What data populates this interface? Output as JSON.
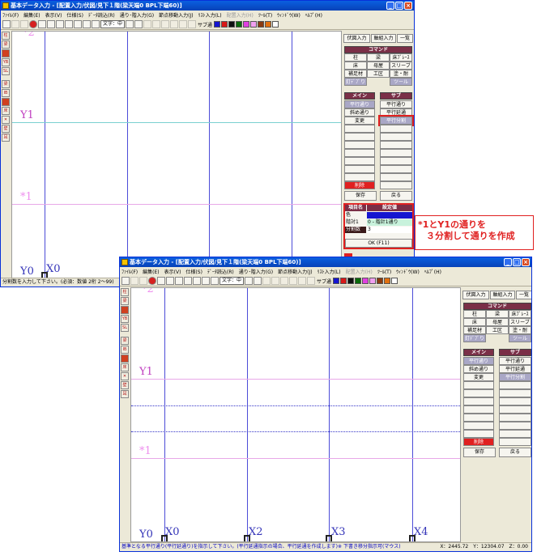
{
  "window1": {
    "title": "基本データ入力 - [配置入力/伏図/見下１階(梁天端0 BPL下端60)]",
    "menus": [
      "ﾌｧｲﾙ(F)",
      "編集(E)",
      "表示(V)",
      "仕様(S)",
      "ﾃﾞｰﾀ読込(R)",
      "通り･階入力(G)",
      "節点移動入力(J)",
      "ﾘｽﾄ入力(L)",
      "配置入力(H)",
      "ﾂｰﾙ(T)",
      "ｳｨﾝﾄﾞｳ(W)",
      "ﾍﾙﾌﾟ(H)"
    ],
    "toolbar": {
      "font_select": "文字：中",
      "sub_label": "サブ通"
    },
    "labels": {
      "top": "*2",
      "y1": "Y1",
      "star1": "*1",
      "y0": "Y0",
      "x0": "X0"
    },
    "status": "分割数を入力して下さい。(必須：数値 2桁 2～99)",
    "panel": {
      "tabs": [
        "伏図入力",
        "軸組入力",
        "一覧"
      ],
      "command_header": "コマンド",
      "commands": [
        "柱",
        "梁",
        "床ﾌﾞﾚｰｽ",
        "床",
        "母屋",
        "スリーブ",
        "補足材",
        "工区",
        "塗・耐",
        "釘ﾃﾞﾌﾞり",
        "ツール"
      ],
      "main_header": "メイン",
      "sub_header": "サブ",
      "main_items": [
        "平行通り",
        "斜め通り",
        "変更"
      ],
      "sub_items": [
        "平行通り",
        "平行延通",
        "平行分割"
      ],
      "delete": "削除",
      "save": "保存",
      "back": "戻る"
    },
    "settings": {
      "col1": "項目名",
      "col2": "設定値",
      "rows": [
        {
          "key": "色",
          "value": ""
        },
        {
          "key": "階対1",
          "value": "0 - 階計1通り"
        },
        {
          "key": "分割数",
          "value": "3"
        }
      ],
      "ok": "OK (F11)"
    }
  },
  "window2": {
    "title": "基本データ入力 - [配置入力/伏図/見下１階(梁天端0 BPL下端60)]",
    "labels": {
      "top": "*2",
      "y1": "Y1",
      "star1": "*1",
      "y0": "Y0",
      "x0": "X0",
      "x2": "X2",
      "x3": "X3",
      "x4": "X4"
    },
    "status": "基準となる平行通り(平行延通り)を指示して下さい。(平行延通指示の場合、平行延通を作成します)※ 下書き移分指示可(マウス)",
    "coords": "X：2445.72　Y：12304.07　Z：0.00"
  },
  "callout": {
    "line1": "*1とY1の通りを",
    "line2": "３分割して通りを作成"
  },
  "colors": {
    "accent_red": "#e02020",
    "header": "#7a2f47",
    "grid_blue": "#4c4cd8",
    "label_magenta": "#c040c0"
  }
}
